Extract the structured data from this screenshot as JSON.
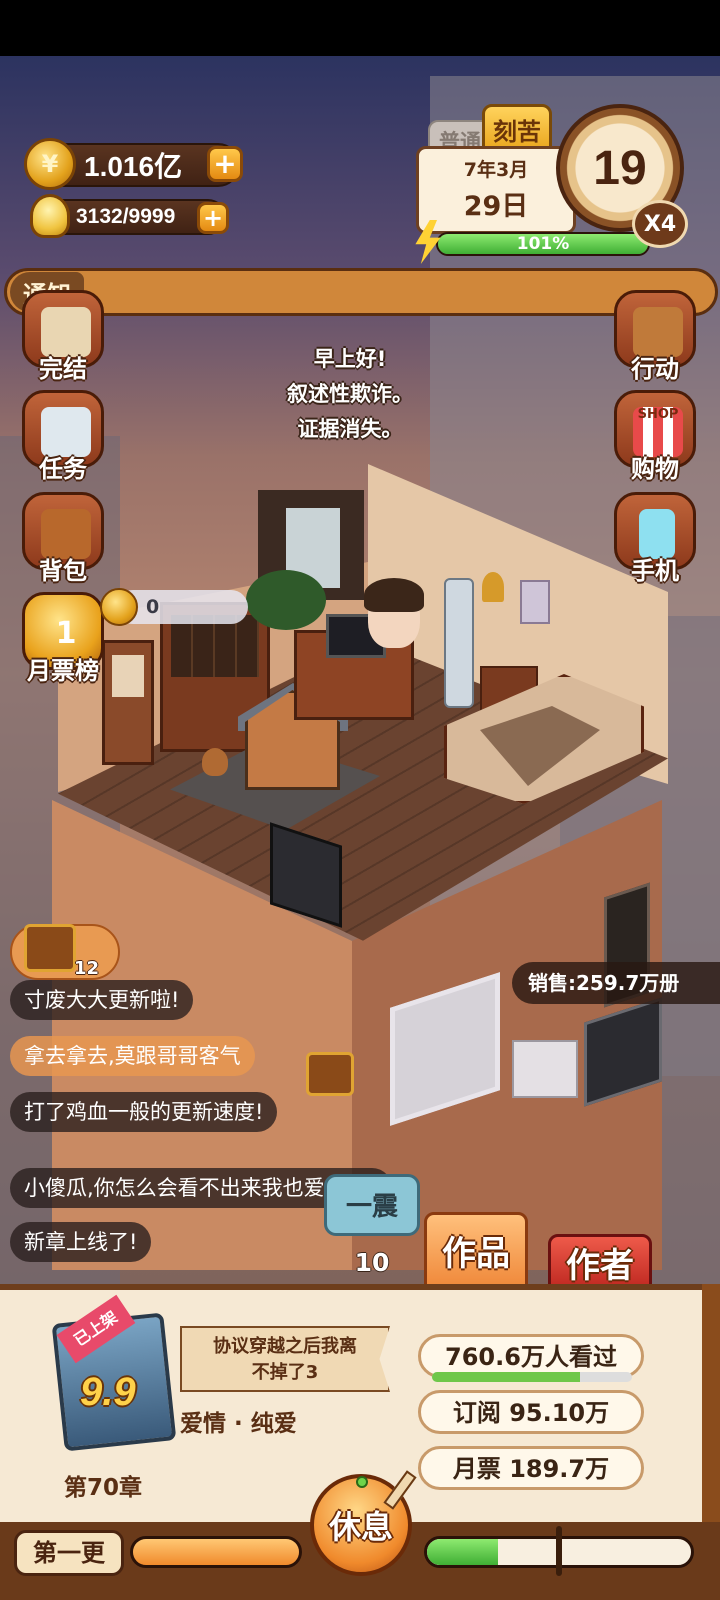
{
  "resources": {
    "coins": "1.016亿",
    "inspiration": "3132/9999"
  },
  "mode": {
    "normal_label": "普通",
    "hard_label": "刻苦"
  },
  "date": {
    "year_month": "7年3月",
    "day": "29日"
  },
  "energy": {
    "label": "101%",
    "fill_percent": 100
  },
  "clock": {
    "hour": "19",
    "speed": "X4"
  },
  "notice": {
    "label": "通知"
  },
  "left_menu": [
    {
      "label": "完结",
      "icon": "book-finish-icon"
    },
    {
      "label": "任务",
      "icon": "task-checklist-icon"
    },
    {
      "label": "背包",
      "icon": "backpack-icon"
    },
    {
      "label": "月票榜",
      "icon": "monthly-ticket-ranking-icon"
    }
  ],
  "right_menu": [
    {
      "label": "行动",
      "icon": "door-action-icon"
    },
    {
      "label": "购物",
      "icon": "shop-icon"
    },
    {
      "label": "手机",
      "icon": "phone-icon"
    }
  ],
  "shop_sign": "SHOP",
  "ranking_badge": "1",
  "speech": {
    "line1": "早上好!",
    "line2": "叙述性欺诈。",
    "line3": "证据消失。"
  },
  "bubble": {
    "value": "0"
  },
  "chest": {
    "count": "12"
  },
  "sales": {
    "text": "销售:259.7万册"
  },
  "comments": [
    "寸废大大更新啦!",
    "拿去拿去,莫跟哥哥客气",
    "打了鸡血一般的更新速度!",
    "小傻瓜,你怎么会看不出来我也爱你呢?",
    "新章上线了!"
  ],
  "vote": {
    "label": "一震",
    "count": "10"
  },
  "tabs": {
    "works": "作品",
    "author": "作者"
  },
  "book": {
    "tag": "已上架",
    "score": "9.9",
    "title_line1": "协议穿越之后我离",
    "title_line2": "不掉了3",
    "genre": "爱情 · 纯爱",
    "chapter": "第70章"
  },
  "stats": {
    "views": "760.6万人看过",
    "views_fill_percent": 74,
    "subscribe": "订阅  95.10万",
    "monthly_ticket": "月票  189.7万"
  },
  "actions": {
    "rest": "休息",
    "first_update": "第一更",
    "left_progress_percent": 100,
    "right_progress_percent": 27
  },
  "colors": {
    "accent_orange": "#f08a2c",
    "energy_green": "#3fae34",
    "panel_bg": "#f6e9d4"
  }
}
